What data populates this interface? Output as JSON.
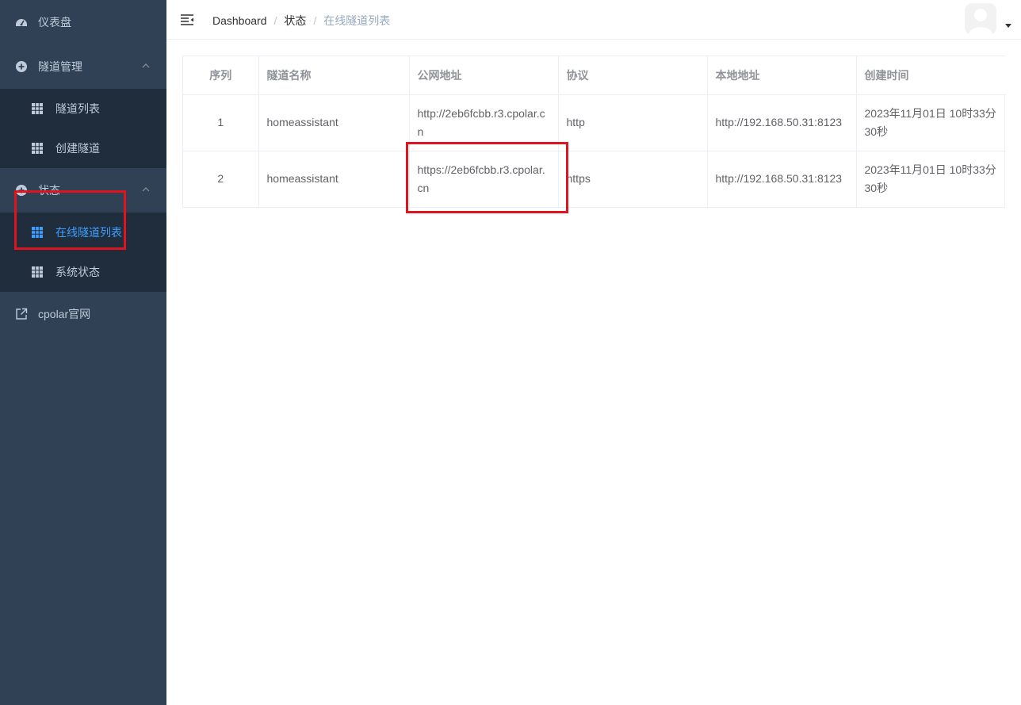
{
  "sidebar": {
    "dashboard": "仪表盘",
    "tunnel_mgmt": "隧道管理",
    "tunnel_list": "隧道列表",
    "create_tunnel": "创建隧道",
    "status": "状态",
    "online_tunnels": "在线隧道列表",
    "system_status": "系统状态",
    "website": "cpolar官网"
  },
  "breadcrumb": [
    "Dashboard",
    "状态",
    "在线隧道列表"
  ],
  "table": {
    "headers": [
      "序列",
      "隧道名称",
      "公网地址",
      "协议",
      "本地地址",
      "创建时间"
    ],
    "rows": [
      [
        "1",
        "homeassistant",
        "http://2eb6fcbb.r3.cpolar.cn",
        "http",
        "http://192.168.50.31:8123",
        "2023年11月01日 10时33分30秒"
      ],
      [
        "2",
        "homeassistant",
        "https://2eb6fcbb.r3.cpolar.cn",
        "https",
        "http://192.168.50.31:8123",
        "2023年11月01日 10时33分30秒"
      ]
    ]
  },
  "colors": {
    "sidebar_bg": "#304156",
    "submenu_bg": "#1f2d3d",
    "active": "#409eff",
    "annotation": "#e0141e"
  }
}
